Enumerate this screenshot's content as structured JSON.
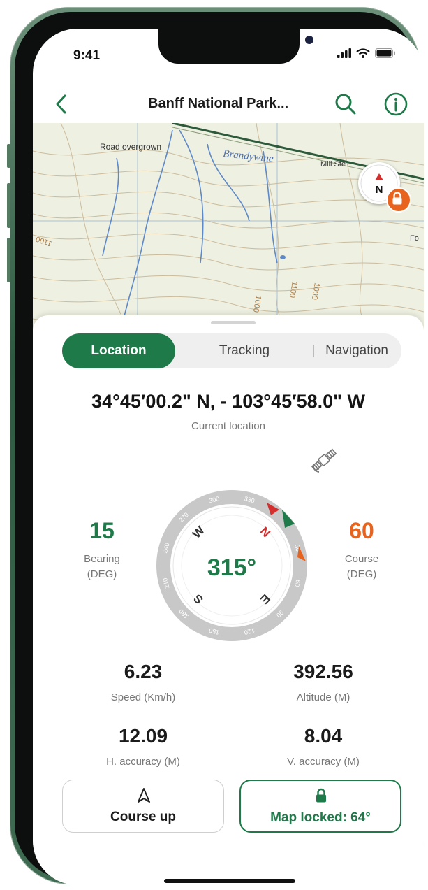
{
  "status": {
    "time": "9:41",
    "signal_icon": "signal-icon",
    "wifi_icon": "wifi-icon",
    "battery_icon": "battery-icon"
  },
  "header": {
    "title": "Banff National Park...",
    "back_icon": "chevron-left-icon",
    "search_icon": "search-icon",
    "info_icon": "info-icon"
  },
  "map": {
    "labels": [
      "Road overgrown",
      "Brandywine",
      "Mill Ste",
      "1100",
      "1000",
      "1100",
      "1000",
      "Fo"
    ],
    "compass_letter": "N",
    "lock_icon": "lock-icon"
  },
  "tabs": [
    {
      "label": "Location",
      "active": true
    },
    {
      "label": "Tracking",
      "active": false
    },
    {
      "label": "Navigation",
      "active": false
    }
  ],
  "location": {
    "coordinates": "34°45′00.2\" N, - 103°45′58.0\" W",
    "label": "Current location"
  },
  "compass": {
    "heading": "315°",
    "ticks": [
      "330",
      "30",
      "60",
      "90",
      "120",
      "150",
      "180",
      "210",
      "240",
      "270",
      "300"
    ],
    "cardinals": [
      "N",
      "E",
      "S",
      "W"
    ]
  },
  "bearing": {
    "value": "15",
    "label_line1": "Bearing",
    "label_line2": "(DEG)"
  },
  "course": {
    "value": "60",
    "label_line1": "Course",
    "label_line2": "(DEG)"
  },
  "stats": [
    {
      "value": "6.23",
      "label": "Speed (Km/h)"
    },
    {
      "value": "392.56",
      "label": "Altitude (M)"
    },
    {
      "value": "12.09",
      "label": "H. accuracy (M)"
    },
    {
      "value": "8.04",
      "label": "V. accuracy (M)"
    }
  ],
  "buttons": {
    "course_up": {
      "label": "Course up",
      "icon": "navigation-arrow-icon"
    },
    "map_locked": {
      "label": "Map locked: 64°",
      "icon": "lock-icon"
    }
  },
  "colors": {
    "brand_green": "#1f7a4a",
    "accent_orange": "#e8631e",
    "compass_red": "#d32f2f"
  }
}
